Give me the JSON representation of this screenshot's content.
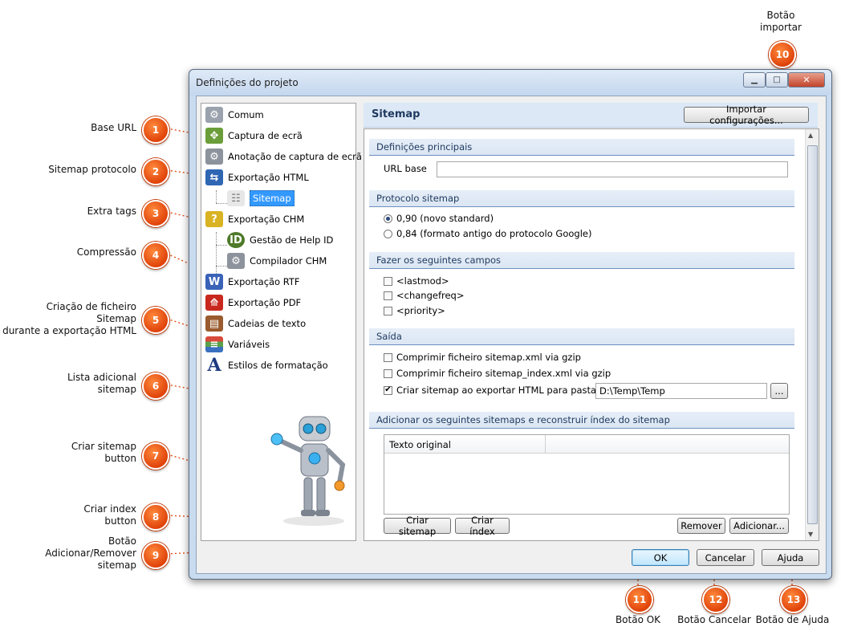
{
  "window": {
    "title": "Definições do projeto",
    "controls": {
      "minimize": "▁",
      "maximize": "□",
      "close": "✕"
    }
  },
  "tree": {
    "items": [
      {
        "label": "Comum",
        "icon": "gear-icon"
      },
      {
        "label": "Captura de ecrã",
        "icon": "screen-capture-icon"
      },
      {
        "label": "Anotação de captura de ecrã",
        "icon": "annotation-icon"
      },
      {
        "label": "Exportação HTML",
        "icon": "html-export-icon"
      },
      {
        "label": "Sitemap",
        "icon": "sitemap-icon"
      },
      {
        "label": "Exportação CHM",
        "icon": "chm-export-icon"
      },
      {
        "label": "Gestão de Help ID",
        "icon": "help-id-icon"
      },
      {
        "label": "Compilador CHM",
        "icon": "compiler-icon"
      },
      {
        "label": "Exportação RTF",
        "icon": "rtf-export-icon"
      },
      {
        "label": "Exportação PDF",
        "icon": "pdf-export-icon"
      },
      {
        "label": "Cadeias de texto",
        "icon": "text-strings-icon"
      },
      {
        "label": "Variáveis",
        "icon": "variables-icon"
      },
      {
        "label": "Estilos de formatação",
        "icon": "styles-icon"
      }
    ]
  },
  "panel": {
    "title": "Sitemap",
    "import_button": "Importar configurações...",
    "sections": {
      "main": "Definições principais",
      "protocol": "Protocolo sitemap",
      "fields": "Fazer os seguintes campos",
      "output": "Saída",
      "additional": "Adicionar os seguintes sitemaps e reconstruir índex do sitemap"
    },
    "url_label": "URL base",
    "url_value": "",
    "protocol_options": [
      "0,90 (novo standard)",
      "0,84 (formato antigo do protocolo Google)"
    ],
    "field_options": [
      "<lastmod>",
      "<changefreq>",
      "<priority>"
    ],
    "output_options": [
      "Comprimir ficheiro sitemap.xml via gzip",
      "Comprimir ficheiro sitemap_index.xml via gzip",
      "Criar sitemap ao exportar HTML para pasta"
    ],
    "export_folder": "D:\\Temp\\Temp",
    "browse_button": "...",
    "grid_header": "Texto original",
    "buttons": {
      "create_sitemap": "Criar sitemap",
      "create_index": "Criar índex",
      "remove": "Remover",
      "add": "Adicionar..."
    }
  },
  "footer": {
    "ok": "OK",
    "cancel": "Cancelar",
    "help": "Ajuda"
  },
  "callouts": [
    {
      "n": "1",
      "label": "Base URL"
    },
    {
      "n": "2",
      "label": "Sitemap protocolo"
    },
    {
      "n": "3",
      "label": "Extra tags"
    },
    {
      "n": "4",
      "label": "Compressão"
    },
    {
      "n": "5",
      "label": "Criação de ficheiro\nSitemap\ndurante a exportação HTML"
    },
    {
      "n": "6",
      "label": "Lista adicional\nsitemap"
    },
    {
      "n": "7",
      "label": "Criar sitemap\nbutton"
    },
    {
      "n": "8",
      "label": "Criar index\nbutton"
    },
    {
      "n": "9",
      "label": "Botão\nAdicionar/Remover\nsitemap"
    },
    {
      "n": "10",
      "label": "Botão\nimportar"
    },
    {
      "n": "11",
      "label": "Botão OK"
    },
    {
      "n": "12",
      "label": "Botão Cancelar"
    },
    {
      "n": "13",
      "label": "Botão de Ajuda"
    }
  ]
}
